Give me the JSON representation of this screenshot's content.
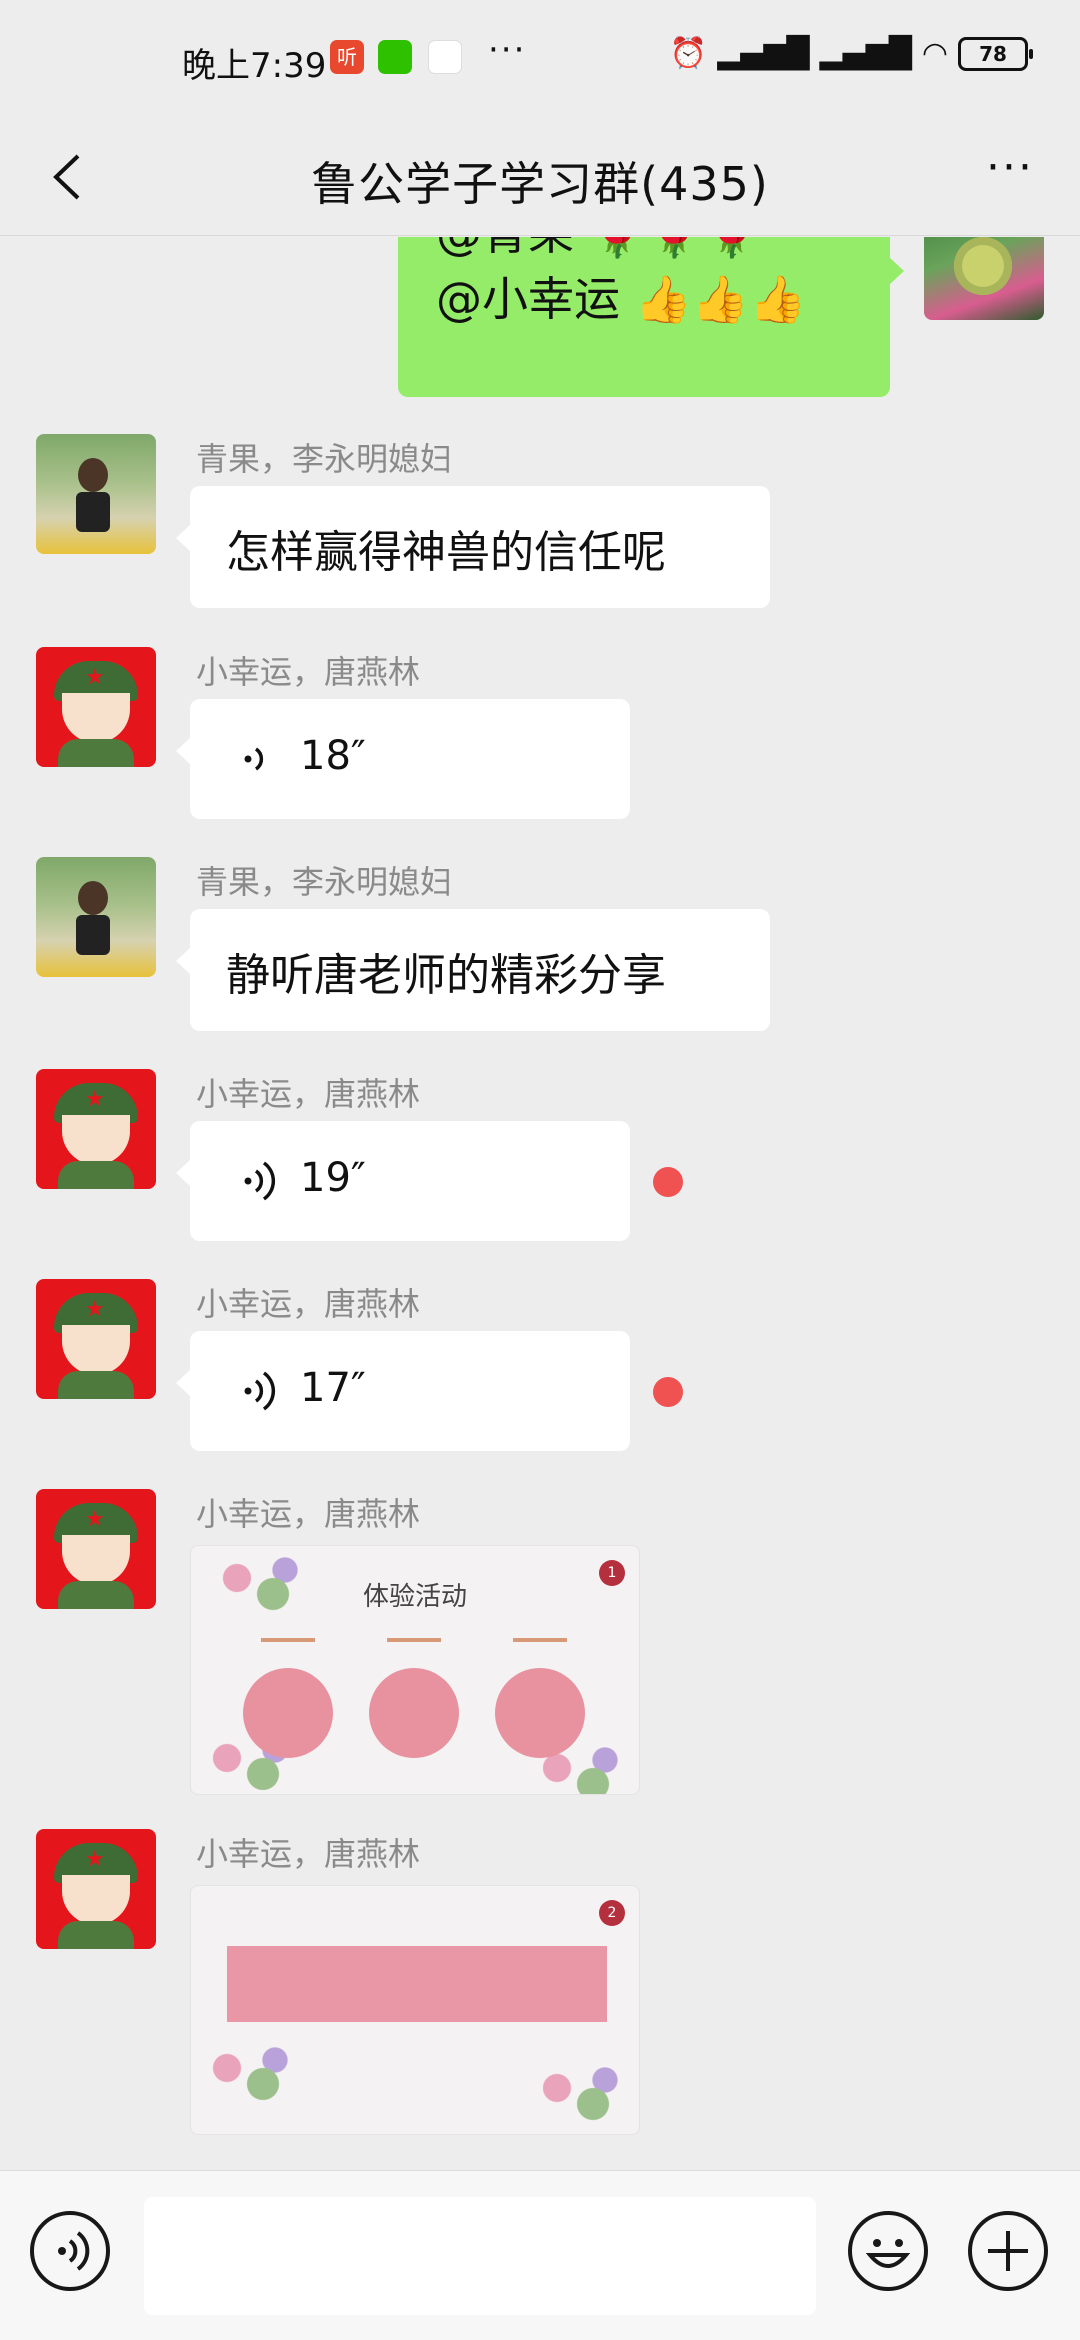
{
  "status_bar": {
    "time": "晚上7:39",
    "app_icon_ting": "听",
    "dots": "···",
    "battery": "78",
    "icons": [
      "alarm-icon",
      "hd-signal-icon",
      "hd-signal-icon",
      "wifi-icon",
      "battery-icon"
    ]
  },
  "nav": {
    "title": "鲁公学子学习群(435)",
    "more": "···"
  },
  "own_message": {
    "line1": "@青果 🌹🌹🌹",
    "line2": "@小幸运 👍👍👍"
  },
  "messages": [
    {
      "sender": "青果，李永明媳妇",
      "type": "text",
      "text": "怎样赢得神兽的信任呢"
    },
    {
      "sender": "小幸运，唐燕林",
      "type": "voice",
      "duration": "18″",
      "unread": false
    },
    {
      "sender": "青果，李永明媳妇",
      "type": "text",
      "text": "静听唐老师的精彩分享"
    },
    {
      "sender": "小幸运，唐燕林",
      "type": "voice",
      "duration": "19″",
      "unread": true
    },
    {
      "sender": "小幸运，唐燕林",
      "type": "voice",
      "duration": "17″",
      "unread": true
    },
    {
      "sender": "小幸运，唐燕林",
      "type": "image",
      "image_title": "体验活动"
    },
    {
      "sender": "小幸运，唐燕林",
      "type": "image",
      "image_title": ""
    }
  ],
  "input": {
    "placeholder": ""
  },
  "colors": {
    "background": "#ededed",
    "own_bubble": "#95ec69",
    "unread_dot": "#f05151",
    "avatar_red": "#e4161c"
  }
}
